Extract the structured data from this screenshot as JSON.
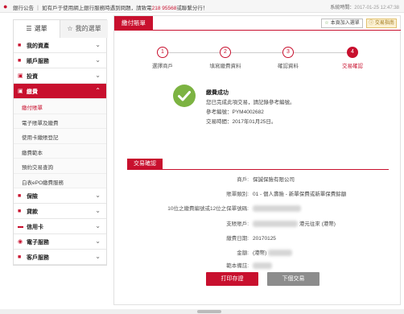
{
  "topbar": {
    "bell_icon": "bell-icon",
    "notice_label": "銀行公告",
    "notice_text": "如有戶于使用網上銀行服務時遇到問題，請致電",
    "notice_phone": "218 95568",
    "notice_tail": "或聯繫分行！",
    "sysclock_label": "系統時間：",
    "sysclock_value": "2017-01-25 12:47:38"
  },
  "sidebar": {
    "tab_menu": "選單",
    "tab_fav": "我的選單",
    "items": [
      {
        "label": "我的資產",
        "icon": "dollar-icon"
      },
      {
        "label": "賬戶服務",
        "icon": "account-icon"
      },
      {
        "label": "投資",
        "icon": "invest-icon"
      },
      {
        "label": "繳費",
        "icon": "payment-icon",
        "active": true
      },
      {
        "label": "保險",
        "icon": "insurance-icon"
      },
      {
        "label": "貸款",
        "icon": "loan-icon"
      },
      {
        "label": "信用卡",
        "icon": "card-icon"
      },
      {
        "label": "電子服務",
        "icon": "eservice-icon"
      },
      {
        "label": "客戶服務",
        "icon": "customer-icon"
      }
    ],
    "sub_items": [
      {
        "label": "繳付賬單",
        "current": true
      },
      {
        "label": "電子賬單及繳費"
      },
      {
        "label": "使用卡繳賬登記"
      },
      {
        "label": "繳費範本"
      },
      {
        "label": "預約交易查詢"
      },
      {
        "label": "白表ePO繳費服務"
      }
    ]
  },
  "main": {
    "header_title": "繳付賬單",
    "fav_button": "本頁加入選單",
    "qa_button": "交易指南",
    "steps": [
      {
        "num": "1",
        "label": "選擇商戶"
      },
      {
        "num": "2",
        "label": "填寫繳費資料"
      },
      {
        "num": "3",
        "label": "確認資料"
      },
      {
        "num": "4",
        "label": "交易確認"
      }
    ],
    "success": {
      "title": "繳費成功",
      "line1": "您已完成此項交易，請記錄參考編號。",
      "line2_label": "參考編號：",
      "line2_value": "PYM4002682",
      "line3_label": "交易時間：",
      "line3_value": "2017年01月25日。"
    },
    "section_title": "交易確認",
    "rows": [
      {
        "key": "商戶:",
        "value": "保誠保險有限公司"
      },
      {
        "key": "賬單類別:",
        "value": "01 - 個人壽險 - 新單保費或新單保費餘額"
      },
      {
        "key": "10位之繳費編號或12位之保單號碼:",
        "value": ""
      },
      {
        "key": "支賬賬戶:",
        "value": "港元往來 (港幣)"
      },
      {
        "key": "繳費日期:",
        "value": "20170125"
      },
      {
        "key": "金額:",
        "value": "(港幣)"
      },
      {
        "key": "範本備註:",
        "value": ""
      }
    ],
    "print_button": "打印存證",
    "next_button": "下個交易"
  }
}
